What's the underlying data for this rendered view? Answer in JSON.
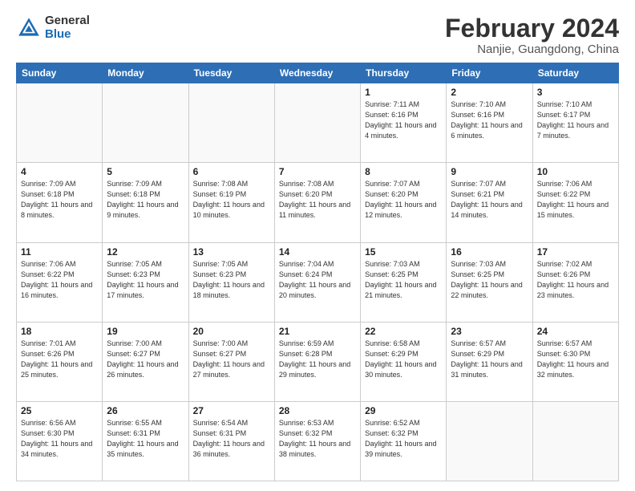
{
  "logo": {
    "general": "General",
    "blue": "Blue"
  },
  "title": {
    "month_year": "February 2024",
    "location": "Nanjie, Guangdong, China"
  },
  "days_of_week": [
    "Sunday",
    "Monday",
    "Tuesday",
    "Wednesday",
    "Thursday",
    "Friday",
    "Saturday"
  ],
  "weeks": [
    [
      {
        "day": "",
        "info": ""
      },
      {
        "day": "",
        "info": ""
      },
      {
        "day": "",
        "info": ""
      },
      {
        "day": "",
        "info": ""
      },
      {
        "day": "1",
        "info": "Sunrise: 7:11 AM\nSunset: 6:16 PM\nDaylight: 11 hours\nand 4 minutes."
      },
      {
        "day": "2",
        "info": "Sunrise: 7:10 AM\nSunset: 6:16 PM\nDaylight: 11 hours\nand 6 minutes."
      },
      {
        "day": "3",
        "info": "Sunrise: 7:10 AM\nSunset: 6:17 PM\nDaylight: 11 hours\nand 7 minutes."
      }
    ],
    [
      {
        "day": "4",
        "info": "Sunrise: 7:09 AM\nSunset: 6:18 PM\nDaylight: 11 hours\nand 8 minutes."
      },
      {
        "day": "5",
        "info": "Sunrise: 7:09 AM\nSunset: 6:18 PM\nDaylight: 11 hours\nand 9 minutes."
      },
      {
        "day": "6",
        "info": "Sunrise: 7:08 AM\nSunset: 6:19 PM\nDaylight: 11 hours\nand 10 minutes."
      },
      {
        "day": "7",
        "info": "Sunrise: 7:08 AM\nSunset: 6:20 PM\nDaylight: 11 hours\nand 11 minutes."
      },
      {
        "day": "8",
        "info": "Sunrise: 7:07 AM\nSunset: 6:20 PM\nDaylight: 11 hours\nand 12 minutes."
      },
      {
        "day": "9",
        "info": "Sunrise: 7:07 AM\nSunset: 6:21 PM\nDaylight: 11 hours\nand 14 minutes."
      },
      {
        "day": "10",
        "info": "Sunrise: 7:06 AM\nSunset: 6:22 PM\nDaylight: 11 hours\nand 15 minutes."
      }
    ],
    [
      {
        "day": "11",
        "info": "Sunrise: 7:06 AM\nSunset: 6:22 PM\nDaylight: 11 hours\nand 16 minutes."
      },
      {
        "day": "12",
        "info": "Sunrise: 7:05 AM\nSunset: 6:23 PM\nDaylight: 11 hours\nand 17 minutes."
      },
      {
        "day": "13",
        "info": "Sunrise: 7:05 AM\nSunset: 6:23 PM\nDaylight: 11 hours\nand 18 minutes."
      },
      {
        "day": "14",
        "info": "Sunrise: 7:04 AM\nSunset: 6:24 PM\nDaylight: 11 hours\nand 20 minutes."
      },
      {
        "day": "15",
        "info": "Sunrise: 7:03 AM\nSunset: 6:25 PM\nDaylight: 11 hours\nand 21 minutes."
      },
      {
        "day": "16",
        "info": "Sunrise: 7:03 AM\nSunset: 6:25 PM\nDaylight: 11 hours\nand 22 minutes."
      },
      {
        "day": "17",
        "info": "Sunrise: 7:02 AM\nSunset: 6:26 PM\nDaylight: 11 hours\nand 23 minutes."
      }
    ],
    [
      {
        "day": "18",
        "info": "Sunrise: 7:01 AM\nSunset: 6:26 PM\nDaylight: 11 hours\nand 25 minutes."
      },
      {
        "day": "19",
        "info": "Sunrise: 7:00 AM\nSunset: 6:27 PM\nDaylight: 11 hours\nand 26 minutes."
      },
      {
        "day": "20",
        "info": "Sunrise: 7:00 AM\nSunset: 6:27 PM\nDaylight: 11 hours\nand 27 minutes."
      },
      {
        "day": "21",
        "info": "Sunrise: 6:59 AM\nSunset: 6:28 PM\nDaylight: 11 hours\nand 29 minutes."
      },
      {
        "day": "22",
        "info": "Sunrise: 6:58 AM\nSunset: 6:29 PM\nDaylight: 11 hours\nand 30 minutes."
      },
      {
        "day": "23",
        "info": "Sunrise: 6:57 AM\nSunset: 6:29 PM\nDaylight: 11 hours\nand 31 minutes."
      },
      {
        "day": "24",
        "info": "Sunrise: 6:57 AM\nSunset: 6:30 PM\nDaylight: 11 hours\nand 32 minutes."
      }
    ],
    [
      {
        "day": "25",
        "info": "Sunrise: 6:56 AM\nSunset: 6:30 PM\nDaylight: 11 hours\nand 34 minutes."
      },
      {
        "day": "26",
        "info": "Sunrise: 6:55 AM\nSunset: 6:31 PM\nDaylight: 11 hours\nand 35 minutes."
      },
      {
        "day": "27",
        "info": "Sunrise: 6:54 AM\nSunset: 6:31 PM\nDaylight: 11 hours\nand 36 minutes."
      },
      {
        "day": "28",
        "info": "Sunrise: 6:53 AM\nSunset: 6:32 PM\nDaylight: 11 hours\nand 38 minutes."
      },
      {
        "day": "29",
        "info": "Sunrise: 6:52 AM\nSunset: 6:32 PM\nDaylight: 11 hours\nand 39 minutes."
      },
      {
        "day": "",
        "info": ""
      },
      {
        "day": "",
        "info": ""
      }
    ]
  ]
}
